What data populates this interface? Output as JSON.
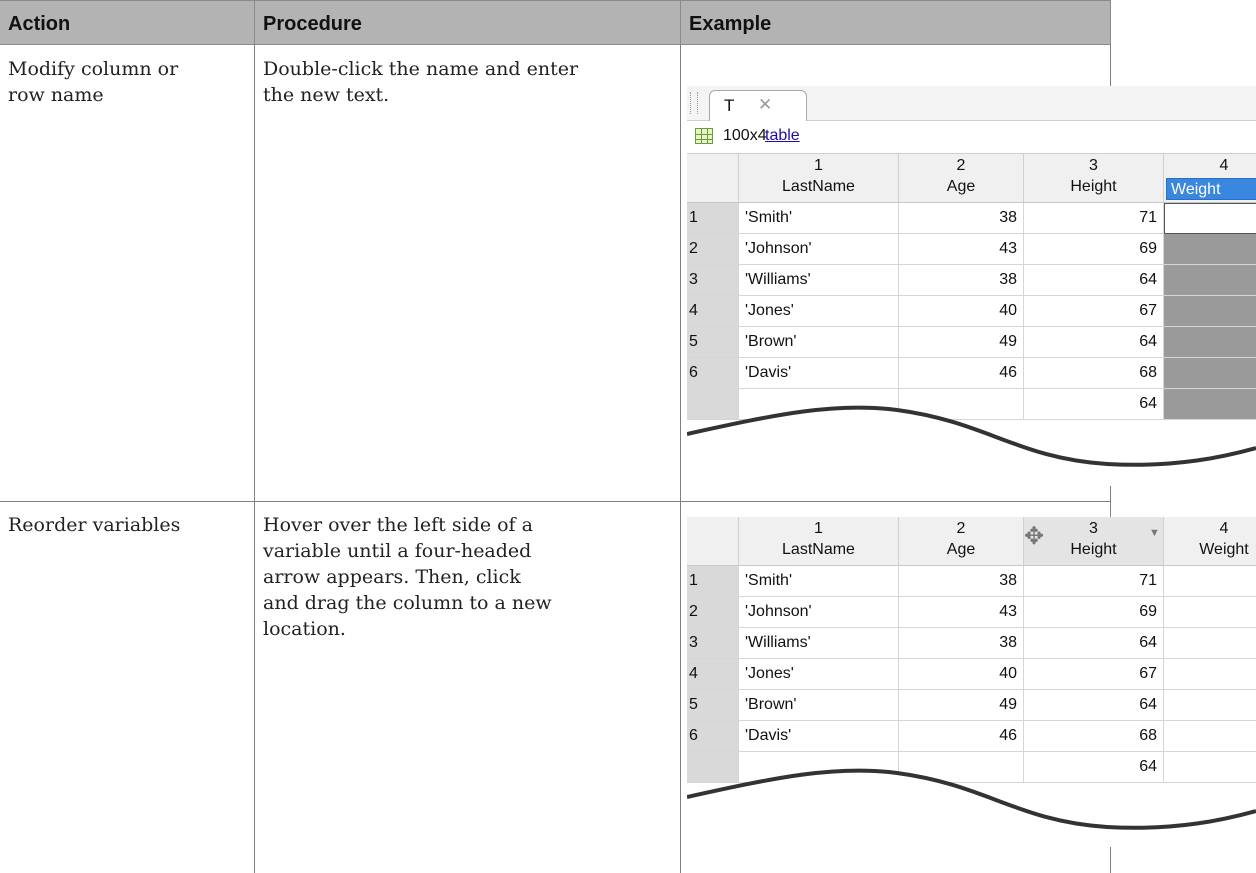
{
  "headers": [
    "Action",
    "Procedure",
    "Example"
  ],
  "rows": [
    {
      "action": [
        "Modify column or",
        "row name"
      ],
      "procedure": [
        "Double-click the name and enter",
        "the new text."
      ]
    },
    {
      "action": [
        "Reorder variables"
      ],
      "procedure": [
        "Hover over the left side of a",
        "variable until a four-headed",
        "arrow appears. Then, click",
        "and drag the column to a new",
        "location."
      ]
    }
  ],
  "example1": {
    "tab_name": "T",
    "tab_close": "✕",
    "dims": "100x4",
    "type_link": "table",
    "columns": [
      {
        "num": "1",
        "name": "LastName"
      },
      {
        "num": "2",
        "name": "Age"
      },
      {
        "num": "3",
        "name": "Height"
      },
      {
        "num": "4",
        "name": "Weight"
      }
    ],
    "row_idx": [
      "1",
      "2",
      "3",
      "4",
      "5",
      "6"
    ],
    "lastnames": [
      "'Smith'",
      "'Johnson'",
      "'Williams'",
      "'Jones'",
      "'Brown'",
      "'Davis'"
    ],
    "ages": [
      "38",
      "43",
      "38",
      "40",
      "49",
      "46"
    ],
    "heights": [
      "71",
      "69",
      "64",
      "67",
      "64",
      "68",
      "64"
    ]
  },
  "example2": {
    "columns": [
      {
        "num": "1",
        "name": "LastName"
      },
      {
        "num": "2",
        "name": "Age"
      },
      {
        "num": "3",
        "name": "Height"
      },
      {
        "num": "4",
        "name": "Weight"
      }
    ],
    "row_idx": [
      "1",
      "2",
      "3",
      "4",
      "5",
      "6"
    ],
    "lastnames": [
      "'Smith'",
      "'Johnson'",
      "'Williams'",
      "'Jones'",
      "'Brown'",
      "'Davis'"
    ],
    "ages": [
      "38",
      "43",
      "38",
      "40",
      "49",
      "46"
    ],
    "heights": [
      "71",
      "69",
      "64",
      "67",
      "64",
      "68",
      "64"
    ],
    "move_icon": "four-headed-arrow-icon",
    "sort_icon": "▼"
  }
}
